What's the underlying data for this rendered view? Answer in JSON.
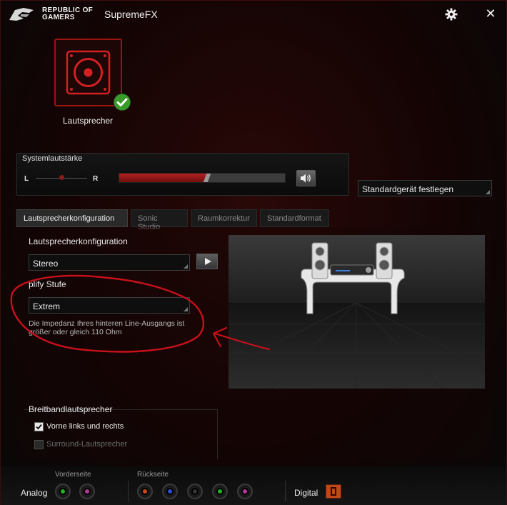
{
  "titlebar": {
    "brand_line1": "REPUBLIC OF",
    "brand_line2": "GAMERS",
    "app_title": "SupremeFX",
    "icons": [
      "rog-logo-icon",
      "gear-icon",
      "close-icon"
    ],
    "close_glyph": "✕"
  },
  "device": {
    "label": "Lautsprecher",
    "status": "check-icon"
  },
  "volume": {
    "title": "Systemlautstärke",
    "left_label": "L",
    "right_label": "R",
    "level_fraction": 0.52,
    "balance_fraction": 0.5
  },
  "default_button": {
    "label": "Standardgerät festlegen"
  },
  "tabs": [
    {
      "label": "Lautsprecherkonfiguration",
      "active": true
    },
    {
      "label": "Sonic Studio",
      "active": false
    },
    {
      "label": "Raumkorrektur",
      "active": false
    },
    {
      "label": "Standardformat",
      "active": false
    }
  ],
  "config": {
    "section_label": "Lautsprecherkonfiguration",
    "speaker_select": "Stereo",
    "amp_label": "plify Stufe",
    "amp_select": "Extrem",
    "info": "Die Impedanz Ihres hinteren Line-Ausgangs ist größer oder gleich 110 Ohm"
  },
  "broadband": {
    "title": "Breitbandlautsprecher",
    "front": {
      "label": "Vorne links und rechts",
      "checked": true
    },
    "surround": {
      "label": "Surround-Lautsprecher",
      "checked": false,
      "disabled": true
    }
  },
  "jacks": {
    "analog_label": "Analog",
    "front_label": "Vorderseite",
    "rear_label": "Rückseite",
    "digital_label": "Digital",
    "front_colors": [
      "#1db81d",
      "#b8359a"
    ],
    "rear_colors": [
      "#c84a1c",
      "#2a4fd0",
      "#333333",
      "#1db81d",
      "#b8359a"
    ]
  },
  "colors": {
    "accent": "#9a1414",
    "annotation": "#c8101a"
  }
}
